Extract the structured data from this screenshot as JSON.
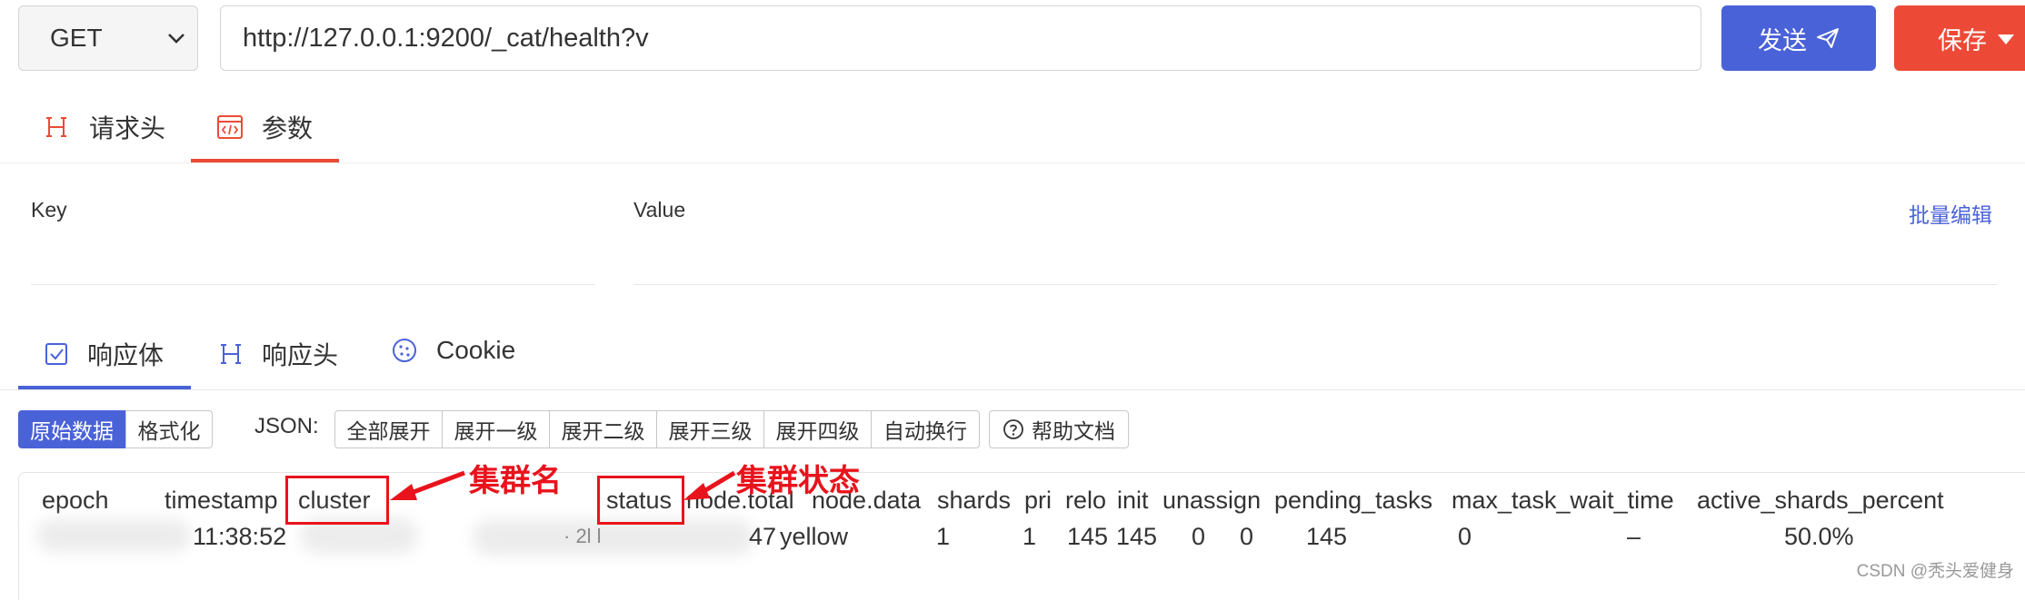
{
  "request": {
    "method": "GET",
    "url": "http://127.0.0.1:9200/_cat/health?v",
    "send_label": "发送",
    "save_label": "保存"
  },
  "request_tabs": [
    {
      "label": "请求头"
    },
    {
      "label": "参数"
    }
  ],
  "params": {
    "key_label": "Key",
    "value_label": "Value",
    "bulk_edit_label": "批量编辑"
  },
  "response_tabs": [
    {
      "label": "响应体"
    },
    {
      "label": "响应头"
    },
    {
      "label": "Cookie"
    }
  ],
  "toolbar": {
    "raw_label": "原始数据",
    "format_label": "格式化",
    "json_label": "JSON:",
    "json_buttons": [
      "全部展开",
      "展开一级",
      "展开二级",
      "展开三级",
      "展开四级",
      "自动换行"
    ],
    "help_label": "帮助文档"
  },
  "output": {
    "headers": [
      "epoch",
      "timestamp",
      "cluster",
      "status",
      "node.total",
      "node.data",
      "shards",
      "pri",
      "relo",
      "init",
      "unassign",
      "pending_tasks",
      "max_task_wait_time",
      "active_shards_percent"
    ],
    "row": {
      "timestamp": "11:38:52",
      "cluster_fragment": "· 2l  l",
      "status_prefix": "47",
      "status": "yellow",
      "shards": "1",
      "pri": "1",
      "relo": "145",
      "init": "145",
      "unassign": "0",
      "pending_tasks": "0",
      "max_task_wait_time": "145",
      "active_shards_percent": "0",
      "dash": "–",
      "percent": "50.0%"
    }
  },
  "annotations": {
    "cluster_note": "集群名",
    "status_note": "集群状态",
    "color": "#e8131c"
  },
  "watermark": "CSDN @秃头爱健身",
  "colors": {
    "send_button": "#4a62d8",
    "save_button": "#ec4a36",
    "active_tab_request": "#ec4a36",
    "active_tab_response": "#4a62d8"
  }
}
